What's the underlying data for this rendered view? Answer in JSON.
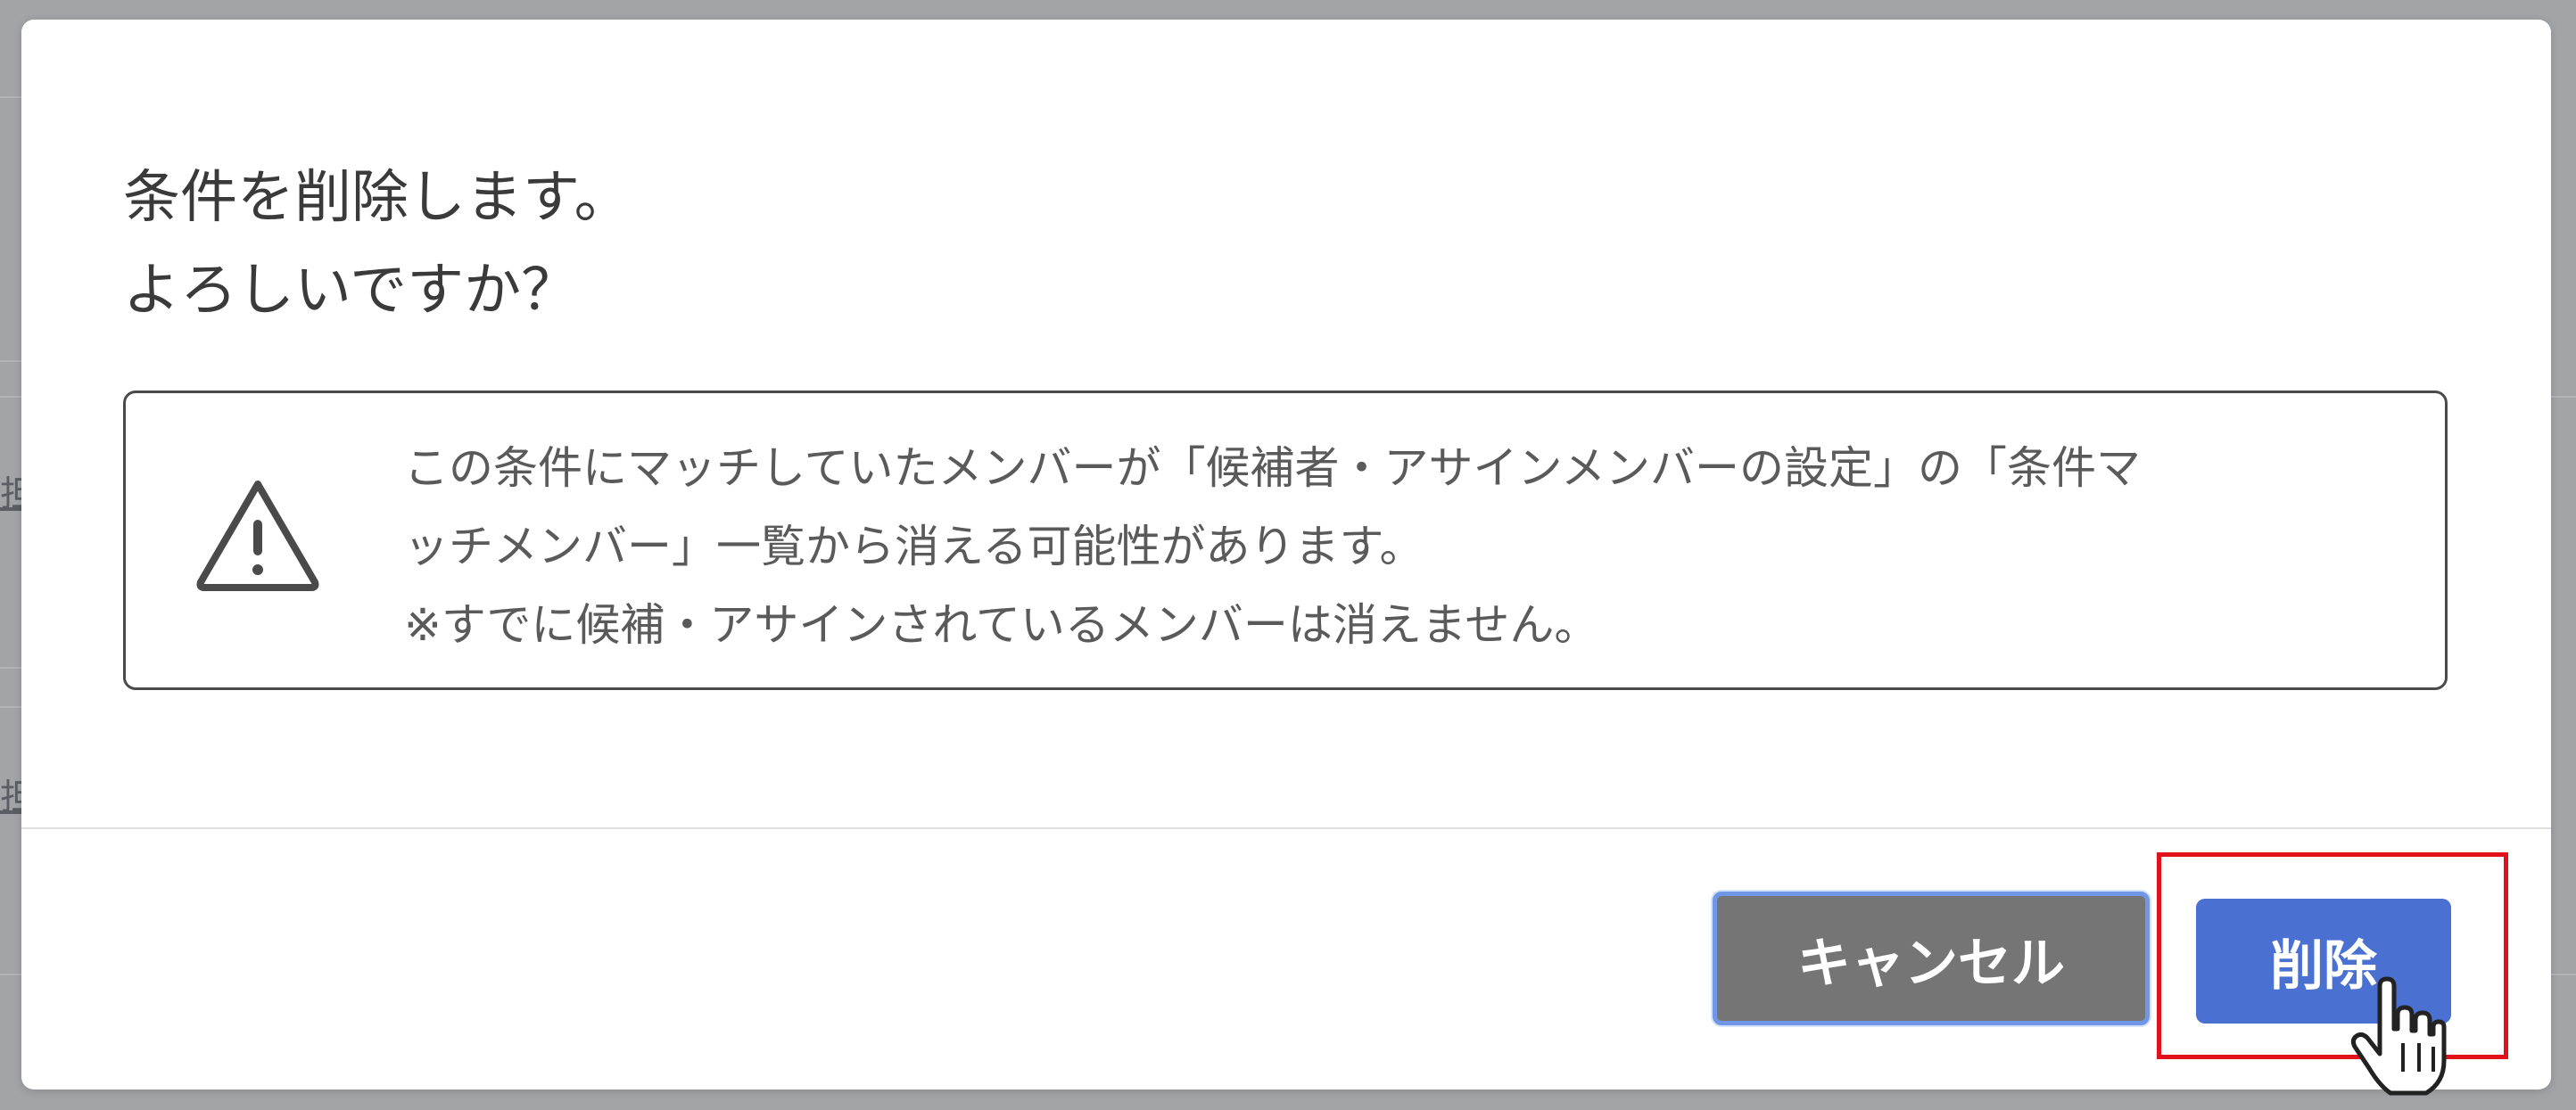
{
  "background": {
    "row_label_1": "担",
    "row_label_2": "担"
  },
  "dialog": {
    "message_line_1": "条件を削除します。",
    "message_line_2": "よろしいですか？",
    "notice": {
      "icon": "warning-triangle-icon",
      "line_1": "この条件にマッチしていたメンバーが「候補者・アサインメンバーの設定」の「条件マ",
      "line_2": "ッチメンバー」一覧から消える可能性があります。",
      "line_3": "※すでに候補・アサインされているメンバーは消えません。"
    },
    "buttons": {
      "cancel_label": "キャンセル",
      "delete_label": "削除"
    }
  },
  "cursor": "hand-pointer-icon",
  "colors": {
    "backdrop": "#a3a4a7",
    "cancel_button": "#757575",
    "delete_button": "#4a70d2",
    "focus_ring": "#6f97e6",
    "highlight_box": "#e0131a"
  }
}
